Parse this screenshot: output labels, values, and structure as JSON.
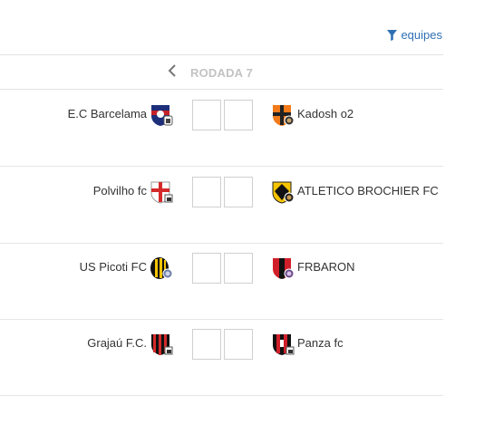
{
  "header": {
    "filter_label": "equipes",
    "filter_icon": "filter-icon",
    "prev_icon": "chevron-left-icon",
    "round_title": "RODADA 7"
  },
  "colors": {
    "accent": "#2f6fb2",
    "muted": "#c3c3c3",
    "divider": "#e6e6e6"
  },
  "matches": [
    {
      "home": {
        "name": "E.C Barcelama",
        "crest": "crest-blue-red-icon"
      },
      "away": {
        "name": "Kadosh o2",
        "crest": "crest-orange-cross-icon"
      },
      "home_score": "",
      "away_score": ""
    },
    {
      "home": {
        "name": "Polvilho fc",
        "crest": "crest-white-red-cross-icon"
      },
      "away": {
        "name": "ATLETICO BROCHIER FC",
        "crest": "crest-yellow-black-icon"
      },
      "home_score": "",
      "away_score": ""
    },
    {
      "home": {
        "name": "US Picoti FC",
        "crest": "crest-yellow-black-stripes-icon"
      },
      "away": {
        "name": "FRBARON",
        "crest": "crest-red-black-icon"
      },
      "home_score": "",
      "away_score": ""
    },
    {
      "home": {
        "name": "Grajaú F.C.",
        "crest": "crest-red-black-stripes-icon"
      },
      "away": {
        "name": "Panza fc",
        "crest": "crest-red-black-white-icon"
      },
      "home_score": "",
      "away_score": ""
    }
  ]
}
